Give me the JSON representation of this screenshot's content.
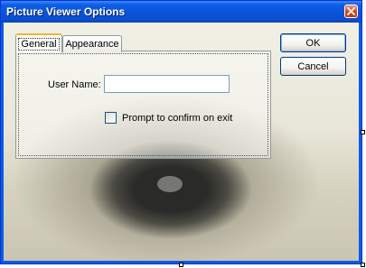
{
  "window": {
    "title": "Picture Viewer Options"
  },
  "tabs": [
    {
      "label": "General",
      "selected": true
    },
    {
      "label": "Appearance",
      "selected": false
    }
  ],
  "general": {
    "username_label": "User Name:",
    "username_value": "",
    "confirm_exit_label": "Prompt to confirm on exit",
    "confirm_exit_checked": false
  },
  "buttons": {
    "ok_label": "OK",
    "cancel_label": "Cancel"
  },
  "icons": {
    "close": "close-icon"
  },
  "colors": {
    "titlebar": "#0a53d8",
    "close_button": "#d44b1c",
    "selected_tab_accent": "#f4b436"
  }
}
